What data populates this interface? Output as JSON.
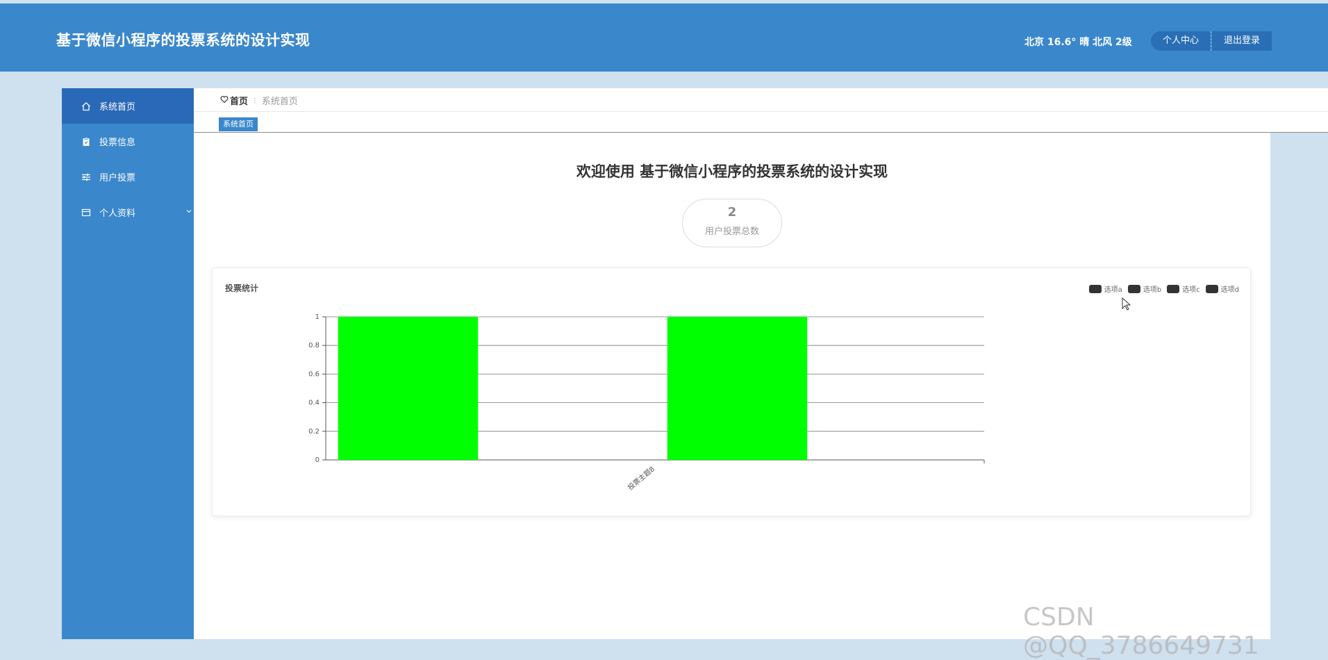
{
  "header": {
    "title": "基于微信小程序的投票系统的设计实现",
    "weather": "北京 16.6° 晴 北风 2级",
    "profile_label": "个人中心",
    "logout_label": "退出登录"
  },
  "sidebar": {
    "items": [
      {
        "label": "系统首页",
        "icon": "home-icon"
      },
      {
        "label": "投票信息",
        "icon": "clipboard-icon"
      },
      {
        "label": "用户投票",
        "icon": "sliders-icon"
      },
      {
        "label": "个人资料",
        "icon": "card-icon"
      }
    ]
  },
  "breadcrumb": {
    "home": "首页",
    "current": "系统首页"
  },
  "tabs": [
    {
      "label": "系统首页"
    }
  ],
  "main": {
    "welcome": "欢迎使用 基于微信小程序的投票系统的设计实现",
    "stat_value": "2",
    "stat_label": "用户投票总数"
  },
  "colors": {
    "header": "#3a87cc",
    "sidebar_active": "#2a69b8",
    "bar": "#00ff00"
  },
  "chart_data": {
    "type": "bar",
    "title": "投票统计",
    "categories": [
      "投票主题8"
    ],
    "series": [
      {
        "name": "选项a",
        "values": [
          1
        ]
      },
      {
        "name": "选项b",
        "values": [
          0
        ]
      },
      {
        "name": "选项c",
        "values": [
          1
        ]
      },
      {
        "name": "选项d",
        "values": [
          0
        ]
      }
    ],
    "yticks": [
      "0",
      "0.2",
      "0.4",
      "0.6",
      "0.8",
      "1"
    ],
    "ylim": [
      0,
      1
    ],
    "grid": true,
    "legend": "top-right"
  },
  "watermark": "CSDN @QQ_3786649731"
}
